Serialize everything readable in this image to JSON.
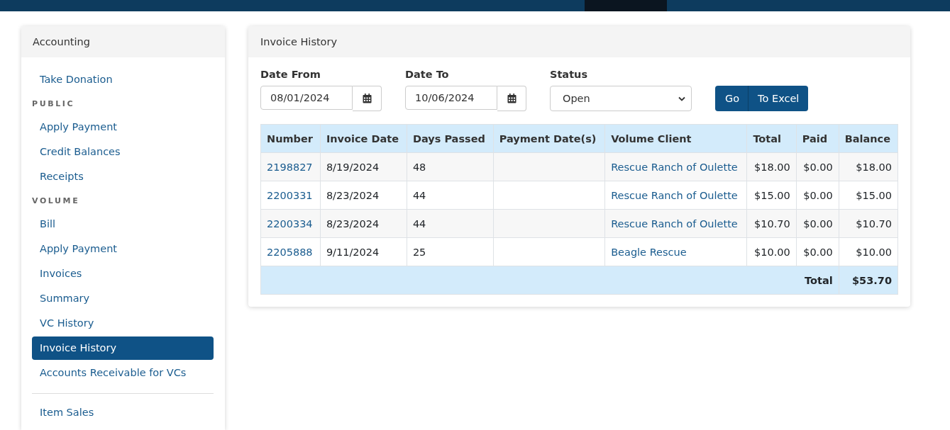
{
  "sidebar": {
    "title": "Accounting",
    "items": [
      {
        "kind": "link",
        "label": "Take Donation",
        "selected": false
      },
      {
        "kind": "heading",
        "label": "PUBLIC"
      },
      {
        "kind": "link",
        "label": "Apply Payment",
        "selected": false
      },
      {
        "kind": "link",
        "label": "Credit Balances",
        "selected": false
      },
      {
        "kind": "link",
        "label": "Receipts",
        "selected": false
      },
      {
        "kind": "heading",
        "label": "VOLUME"
      },
      {
        "kind": "link",
        "label": "Bill",
        "selected": false
      },
      {
        "kind": "link",
        "label": "Apply Payment",
        "selected": false
      },
      {
        "kind": "link",
        "label": "Invoices",
        "selected": false
      },
      {
        "kind": "link",
        "label": "Summary",
        "selected": false
      },
      {
        "kind": "link",
        "label": "VC History",
        "selected": false
      },
      {
        "kind": "link",
        "label": "Invoice History",
        "selected": true
      },
      {
        "kind": "link",
        "label": "Accounts Receivable for VCs",
        "selected": false
      },
      {
        "kind": "divider"
      },
      {
        "kind": "link",
        "label": "Item Sales",
        "selected": false
      }
    ]
  },
  "main": {
    "title": "Invoice History",
    "filters": [
      {
        "kind": "date",
        "label": "Date From",
        "value": "08/01/2024"
      },
      {
        "kind": "date",
        "label": "Date To",
        "value": "10/06/2024"
      },
      {
        "kind": "select",
        "label": "Status",
        "value": "Open"
      }
    ],
    "buttons": [
      "Go",
      "To Excel"
    ],
    "table": {
      "columns": [
        {
          "label": "Number",
          "kind": "link"
        },
        {
          "label": "Invoice Date",
          "kind": "text"
        },
        {
          "label": "Days Passed",
          "kind": "text"
        },
        {
          "label": "Payment Date(s)",
          "kind": "text"
        },
        {
          "label": "Volume Client",
          "kind": "link"
        },
        {
          "label": "Total",
          "kind": "money"
        },
        {
          "label": "Paid",
          "kind": "money"
        },
        {
          "label": "Balance",
          "kind": "money"
        }
      ],
      "rows": [
        [
          "2198827",
          "8/19/2024",
          "48",
          "",
          "Rescue Ranch of Oulette",
          "$18.00",
          "$0.00",
          "$18.00"
        ],
        [
          "2200331",
          "8/23/2024",
          "44",
          "",
          "Rescue Ranch of Oulette",
          "$15.00",
          "$0.00",
          "$15.00"
        ],
        [
          "2200334",
          "8/23/2024",
          "44",
          "",
          "Rescue Ranch of Oulette",
          "$10.70",
          "$0.00",
          "$10.70"
        ],
        [
          "2205888",
          "9/11/2024",
          "25",
          "",
          "Beagle Rescue",
          "$10.00",
          "$0.00",
          "$10.00"
        ]
      ],
      "footer": {
        "label": "Total",
        "value": "$53.70"
      }
    }
  }
}
